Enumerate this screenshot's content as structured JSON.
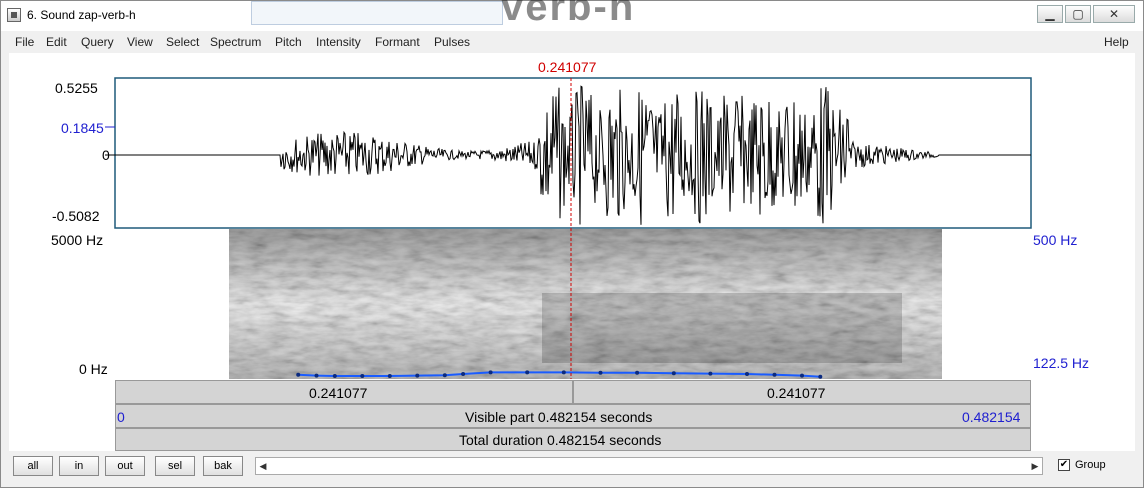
{
  "window": {
    "title": "6. Sound zap-verb-h",
    "background_title_fragment": "verb-h",
    "minimize_glyph": "▁",
    "maximize_glyph": "▢",
    "close_glyph": "✕"
  },
  "menu": {
    "items": [
      "File",
      "Edit",
      "Query",
      "View",
      "Select",
      "Spectrum",
      "Pitch",
      "Intensity",
      "Formant",
      "Pulses"
    ],
    "help": "Help"
  },
  "cursor": {
    "time_label": "0.241077",
    "time": 0.241077,
    "color": "#d00000"
  },
  "waveform": {
    "y_max": "0.5255",
    "y_marker": "0.1845",
    "y_zero": "0",
    "y_min": "-0.5082"
  },
  "spectrogram": {
    "freq_max": "5000 Hz",
    "freq_min": "0 Hz",
    "pitch_max": "500 Hz",
    "pitch_min": "122.5 Hz"
  },
  "time_bars": {
    "left_duration": "0.241077",
    "right_duration": "0.241077",
    "visible_start": "0",
    "visible_part": "Visible part 0.482154 seconds",
    "visible_end": "0.482154",
    "total_duration": "Total duration 0.482154 seconds"
  },
  "bottom": {
    "buttons": [
      "all",
      "in",
      "out",
      "sel",
      "bak"
    ],
    "scroll_left": "◀",
    "scroll_right": "▶",
    "group_checked": "✔",
    "group_label": "Group"
  },
  "colors": {
    "pitch_line": "#1a5cff",
    "label_blue": "#2020d0",
    "frame": "#1f5a7a"
  },
  "icons": {
    "title": "praat-sound-icon"
  }
}
